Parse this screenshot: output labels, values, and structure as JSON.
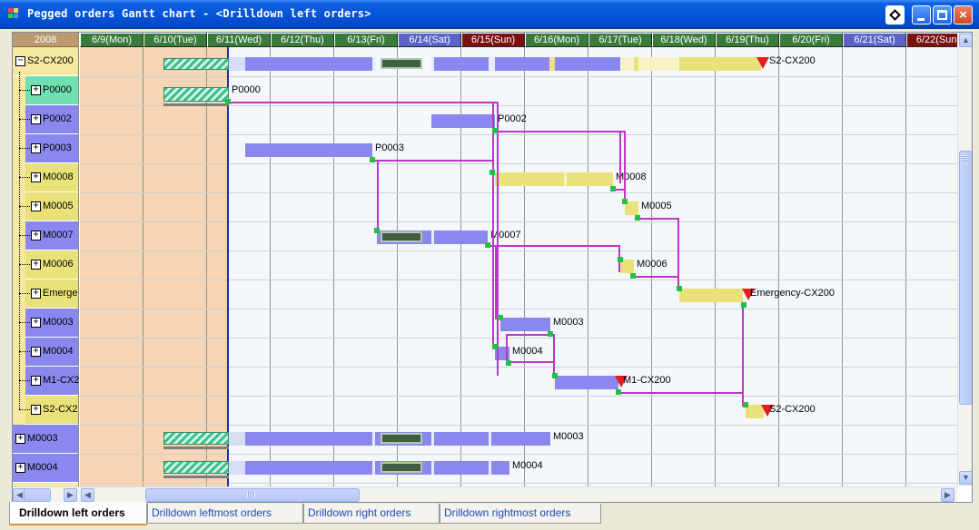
{
  "window": {
    "title": "Pegged orders Gantt chart - <Drilldown left orders>",
    "buttons": {
      "close_glyph": "×"
    }
  },
  "chart": {
    "year": "2008",
    "dates": [
      {
        "label": "6/9(Mon)",
        "kind": "weekday"
      },
      {
        "label": "6/10(Tue)",
        "kind": "weekday"
      },
      {
        "label": "6/11(Wed)",
        "kind": "weekday"
      },
      {
        "label": "6/12(Thu)",
        "kind": "weekday"
      },
      {
        "label": "6/13(Fri)",
        "kind": "weekday"
      },
      {
        "label": "6/14(Sat)",
        "kind": "saturday"
      },
      {
        "label": "6/15(Sun)",
        "kind": "sunday"
      },
      {
        "label": "6/16(Mon)",
        "kind": "weekday"
      },
      {
        "label": "6/17(Tue)",
        "kind": "weekday"
      },
      {
        "label": "6/18(Wed)",
        "kind": "weekday"
      },
      {
        "label": "6/19(Thu)",
        "kind": "weekday"
      },
      {
        "label": "6/20(Fri)",
        "kind": "weekday"
      },
      {
        "label": "6/21(Sat)",
        "kind": "saturday"
      },
      {
        "label": "6/22(Sun)",
        "kind": "sunday"
      }
    ],
    "colors": {
      "weekday": "#3a7a3a",
      "saturday": "#5b62c8",
      "sunday": "#7a1010",
      "past": "#f8d5b4",
      "link": "#c035c8",
      "blue_bar": "#8a88ee",
      "yellow_bar": "#e9e27a"
    }
  },
  "tree": {
    "rows": [
      {
        "label": "S2-CX200",
        "expander": "−",
        "color": "#f6e7a1"
      },
      {
        "label": "P0000",
        "expander": "+",
        "color": "#6fe0b2"
      },
      {
        "label": "P0002",
        "expander": "+",
        "color": "#8a88ee"
      },
      {
        "label": "P0003",
        "expander": "+",
        "color": "#8a88ee"
      },
      {
        "label": "M0008",
        "expander": "+",
        "color": "#e9e27a"
      },
      {
        "label": "M0005",
        "expander": "+",
        "color": "#e9e27a"
      },
      {
        "label": "M0007",
        "expander": "+",
        "color": "#8a88ee"
      },
      {
        "label": "M0006",
        "expander": "+",
        "color": "#e9e27a"
      },
      {
        "label": "Emerge",
        "expander": "+",
        "color": "#e9e27a"
      },
      {
        "label": "M0003",
        "expander": "+",
        "color": "#8a88ee"
      },
      {
        "label": "M0004",
        "expander": "+",
        "color": "#8a88ee"
      },
      {
        "label": "M1-CX2",
        "expander": "+",
        "color": "#8a88ee"
      },
      {
        "label": "S2-CX2",
        "expander": "+",
        "color": "#e9e27a"
      },
      {
        "label": "M0003",
        "expander": "+",
        "color": "#8a88ee"
      },
      {
        "label": "M0004",
        "expander": "+",
        "color": "#8a88ee"
      }
    ]
  },
  "bar_labels": {
    "s2_top": "S2-CX200",
    "p0000": "P0000",
    "p0002": "P0002",
    "p0003": "P0003",
    "m0008": "M0008",
    "m0005": "M0005",
    "m0007": "M0007",
    "m0006": "M0006",
    "emergency": "Emergency-CX200",
    "m0003_sub": "M0003",
    "m0004_sub": "M0004",
    "m1": "M1-CX200",
    "s2_sub": "S2-CX200",
    "m0003_top": "M0003",
    "m0004_top": "M0004"
  },
  "scroll": {
    "up": "▲",
    "down": "▼",
    "left": "◀",
    "right": "▶"
  },
  "tabs": [
    {
      "label": "Drilldown left orders",
      "active": true
    },
    {
      "label": "Drilldown leftmost orders",
      "active": false
    },
    {
      "label": "Drilldown right orders",
      "active": false
    },
    {
      "label": "Drilldown rightmost orders",
      "active": false
    }
  ]
}
